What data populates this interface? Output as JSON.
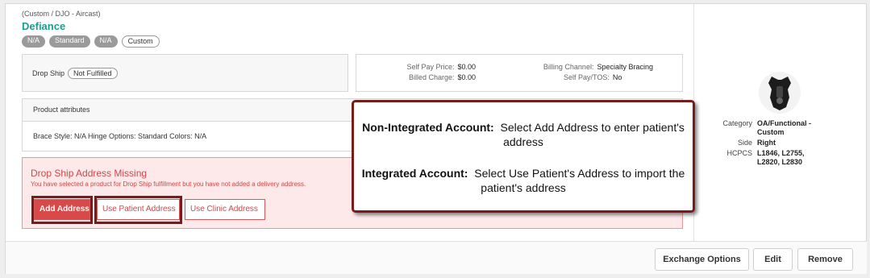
{
  "product": {
    "category_line": "(Custom / DJO - Aircast)",
    "name": "Defiance",
    "tags": [
      "N/A",
      "Standard",
      "N/A",
      "Custom"
    ]
  },
  "drop_ship": {
    "label": "Drop Ship",
    "status": "Not Fulfilled"
  },
  "pricing": {
    "self_pay_price_label": "Self Pay Price:",
    "self_pay_price": "$0.00",
    "billed_charge_label": "Billed Charge:",
    "billed_charge": "$0.00",
    "billing_channel_label": "Billing Channel:",
    "billing_channel": "Specialty Bracing",
    "self_pay_tos_label": "Self Pay/TOS:",
    "self_pay_tos": "No"
  },
  "attributes": {
    "header": "Product attributes",
    "text": "Brace Style: N/A Hinge Options: Standard Colors: N/A"
  },
  "alert": {
    "title": "Drop Ship Address Missing",
    "message": "You have selected a product for Drop Ship fulfillment but you have not added a delivery address.",
    "buttons": {
      "add": "Add Address",
      "use_patient": "Use Patient Address",
      "use_clinic": "Use Clinic Address"
    }
  },
  "callout": {
    "line1_bold": "Non-Integrated Account:",
    "line1_rest": "Select Add Address to enter patient's address",
    "line2_bold": "Integrated Account:",
    "line2_rest": "Select Use Patient's Address to import the patient's address"
  },
  "specs": {
    "category_label": "Category",
    "category": "OA/Functional - Custom",
    "side_label": "Side",
    "side": "Right",
    "hcpcs_label": "HCPCS",
    "hcpcs": "L1846, L2755, L2820, L2830"
  },
  "footer": {
    "exchange": "Exchange Options",
    "edit": "Edit",
    "remove": "Remove"
  },
  "colors": {
    "accent_teal": "#1aa08f",
    "alert_red": "#d0474a",
    "highlight_dark_red": "#7a1b1b"
  }
}
